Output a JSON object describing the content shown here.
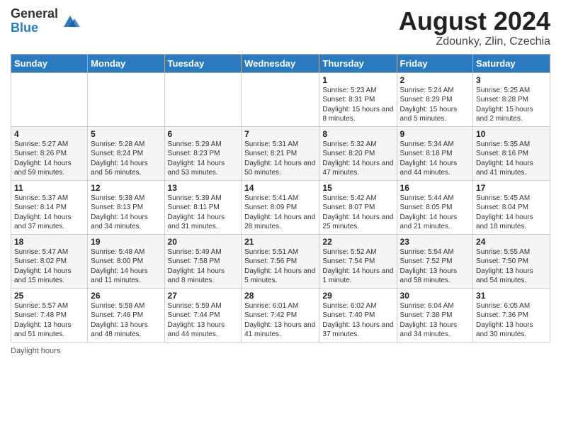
{
  "header": {
    "logo_general": "General",
    "logo_blue": "Blue",
    "month_year": "August 2024",
    "location": "Zdounky, Zlin, Czechia"
  },
  "weekdays": [
    "Sunday",
    "Monday",
    "Tuesday",
    "Wednesday",
    "Thursday",
    "Friday",
    "Saturday"
  ],
  "footer": {
    "daylight_label": "Daylight hours"
  },
  "weeks": [
    [
      {
        "day": "",
        "sunrise": "",
        "sunset": "",
        "daylight": ""
      },
      {
        "day": "",
        "sunrise": "",
        "sunset": "",
        "daylight": ""
      },
      {
        "day": "",
        "sunrise": "",
        "sunset": "",
        "daylight": ""
      },
      {
        "day": "",
        "sunrise": "",
        "sunset": "",
        "daylight": ""
      },
      {
        "day": "1",
        "sunrise": "Sunrise: 5:23 AM",
        "sunset": "Sunset: 8:31 PM",
        "daylight": "Daylight: 15 hours and 8 minutes."
      },
      {
        "day": "2",
        "sunrise": "Sunrise: 5:24 AM",
        "sunset": "Sunset: 8:29 PM",
        "daylight": "Daylight: 15 hours and 5 minutes."
      },
      {
        "day": "3",
        "sunrise": "Sunrise: 5:25 AM",
        "sunset": "Sunset: 8:28 PM",
        "daylight": "Daylight: 15 hours and 2 minutes."
      }
    ],
    [
      {
        "day": "4",
        "sunrise": "Sunrise: 5:27 AM",
        "sunset": "Sunset: 8:26 PM",
        "daylight": "Daylight: 14 hours and 59 minutes."
      },
      {
        "day": "5",
        "sunrise": "Sunrise: 5:28 AM",
        "sunset": "Sunset: 8:24 PM",
        "daylight": "Daylight: 14 hours and 56 minutes."
      },
      {
        "day": "6",
        "sunrise": "Sunrise: 5:29 AM",
        "sunset": "Sunset: 8:23 PM",
        "daylight": "Daylight: 14 hours and 53 minutes."
      },
      {
        "day": "7",
        "sunrise": "Sunrise: 5:31 AM",
        "sunset": "Sunset: 8:21 PM",
        "daylight": "Daylight: 14 hours and 50 minutes."
      },
      {
        "day": "8",
        "sunrise": "Sunrise: 5:32 AM",
        "sunset": "Sunset: 8:20 PM",
        "daylight": "Daylight: 14 hours and 47 minutes."
      },
      {
        "day": "9",
        "sunrise": "Sunrise: 5:34 AM",
        "sunset": "Sunset: 8:18 PM",
        "daylight": "Daylight: 14 hours and 44 minutes."
      },
      {
        "day": "10",
        "sunrise": "Sunrise: 5:35 AM",
        "sunset": "Sunset: 8:16 PM",
        "daylight": "Daylight: 14 hours and 41 minutes."
      }
    ],
    [
      {
        "day": "11",
        "sunrise": "Sunrise: 5:37 AM",
        "sunset": "Sunset: 8:14 PM",
        "daylight": "Daylight: 14 hours and 37 minutes."
      },
      {
        "day": "12",
        "sunrise": "Sunrise: 5:38 AM",
        "sunset": "Sunset: 8:13 PM",
        "daylight": "Daylight: 14 hours and 34 minutes."
      },
      {
        "day": "13",
        "sunrise": "Sunrise: 5:39 AM",
        "sunset": "Sunset: 8:11 PM",
        "daylight": "Daylight: 14 hours and 31 minutes."
      },
      {
        "day": "14",
        "sunrise": "Sunrise: 5:41 AM",
        "sunset": "Sunset: 8:09 PM",
        "daylight": "Daylight: 14 hours and 28 minutes."
      },
      {
        "day": "15",
        "sunrise": "Sunrise: 5:42 AM",
        "sunset": "Sunset: 8:07 PM",
        "daylight": "Daylight: 14 hours and 25 minutes."
      },
      {
        "day": "16",
        "sunrise": "Sunrise: 5:44 AM",
        "sunset": "Sunset: 8:05 PM",
        "daylight": "Daylight: 14 hours and 21 minutes."
      },
      {
        "day": "17",
        "sunrise": "Sunrise: 5:45 AM",
        "sunset": "Sunset: 8:04 PM",
        "daylight": "Daylight: 14 hours and 18 minutes."
      }
    ],
    [
      {
        "day": "18",
        "sunrise": "Sunrise: 5:47 AM",
        "sunset": "Sunset: 8:02 PM",
        "daylight": "Daylight: 14 hours and 15 minutes."
      },
      {
        "day": "19",
        "sunrise": "Sunrise: 5:48 AM",
        "sunset": "Sunset: 8:00 PM",
        "daylight": "Daylight: 14 hours and 11 minutes."
      },
      {
        "day": "20",
        "sunrise": "Sunrise: 5:49 AM",
        "sunset": "Sunset: 7:58 PM",
        "daylight": "Daylight: 14 hours and 8 minutes."
      },
      {
        "day": "21",
        "sunrise": "Sunrise: 5:51 AM",
        "sunset": "Sunset: 7:56 PM",
        "daylight": "Daylight: 14 hours and 5 minutes."
      },
      {
        "day": "22",
        "sunrise": "Sunrise: 5:52 AM",
        "sunset": "Sunset: 7:54 PM",
        "daylight": "Daylight: 14 hours and 1 minute."
      },
      {
        "day": "23",
        "sunrise": "Sunrise: 5:54 AM",
        "sunset": "Sunset: 7:52 PM",
        "daylight": "Daylight: 13 hours and 58 minutes."
      },
      {
        "day": "24",
        "sunrise": "Sunrise: 5:55 AM",
        "sunset": "Sunset: 7:50 PM",
        "daylight": "Daylight: 13 hours and 54 minutes."
      }
    ],
    [
      {
        "day": "25",
        "sunrise": "Sunrise: 5:57 AM",
        "sunset": "Sunset: 7:48 PM",
        "daylight": "Daylight: 13 hours and 51 minutes."
      },
      {
        "day": "26",
        "sunrise": "Sunrise: 5:58 AM",
        "sunset": "Sunset: 7:46 PM",
        "daylight": "Daylight: 13 hours and 48 minutes."
      },
      {
        "day": "27",
        "sunrise": "Sunrise: 5:59 AM",
        "sunset": "Sunset: 7:44 PM",
        "daylight": "Daylight: 13 hours and 44 minutes."
      },
      {
        "day": "28",
        "sunrise": "Sunrise: 6:01 AM",
        "sunset": "Sunset: 7:42 PM",
        "daylight": "Daylight: 13 hours and 41 minutes."
      },
      {
        "day": "29",
        "sunrise": "Sunrise: 6:02 AM",
        "sunset": "Sunset: 7:40 PM",
        "daylight": "Daylight: 13 hours and 37 minutes."
      },
      {
        "day": "30",
        "sunrise": "Sunrise: 6:04 AM",
        "sunset": "Sunset: 7:38 PM",
        "daylight": "Daylight: 13 hours and 34 minutes."
      },
      {
        "day": "31",
        "sunrise": "Sunrise: 6:05 AM",
        "sunset": "Sunset: 7:36 PM",
        "daylight": "Daylight: 13 hours and 30 minutes."
      }
    ]
  ]
}
